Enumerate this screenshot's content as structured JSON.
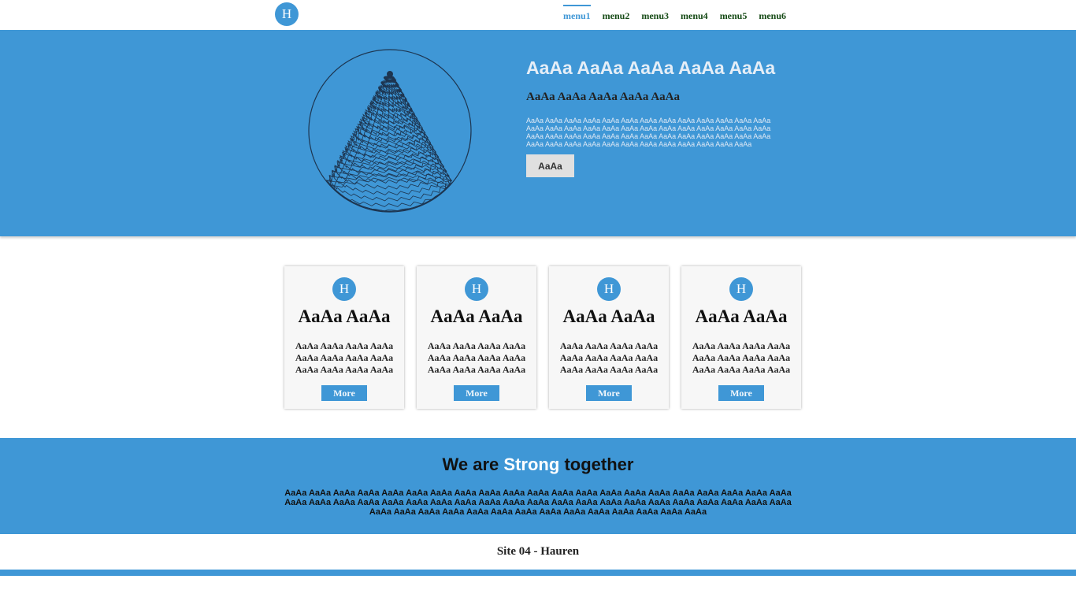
{
  "header": {
    "logo_letter": "H",
    "nav": [
      {
        "label": "menu1",
        "active": true
      },
      {
        "label": "menu2"
      },
      {
        "label": "menu3"
      },
      {
        "label": "menu4"
      },
      {
        "label": "menu5"
      },
      {
        "label": "menu6"
      }
    ]
  },
  "hero": {
    "image_icon": "sphere-illustration",
    "title": "AaAa AaAa AaAa AaAa AaAa",
    "subtitle": "AaAa AaAa AaAa AaAa AaAa",
    "text": "AaAa AaAa AaAa AaAa AaAa AaAa AaAa AaAa AaAa AaAa AaAa AaAa AaAa AaAa AaAa AaAa AaAa AaAa AaAa AaAa AaAa AaAa AaAa AaAa AaAa AaAa AaAa AaAa AaAa AaAa AaAa AaAa AaAa AaAa AaAa AaAa AaAa AaAa AaAa AaAa AaAa AaAa AaAa AaAa AaAa AaAa AaAa AaAa AaAa AaAa AaAa",
    "button_label": "AaAa"
  },
  "cards": [
    {
      "icon_letter": "H",
      "title": "AaAa AaAa",
      "text": "AaAa AaAa AaAa AaAa AaAa AaAa AaAa AaAa AaAa AaAa AaAa AaAa",
      "button_label": "More"
    },
    {
      "icon_letter": "H",
      "title": "AaAa AaAa",
      "text": "AaAa AaAa AaAa AaAa AaAa AaAa AaAa AaAa AaAa AaAa AaAa AaAa",
      "button_label": "More"
    },
    {
      "icon_letter": "H",
      "title": "AaAa AaAa",
      "text": "AaAa AaAa AaAa AaAa AaAa AaAa AaAa AaAa AaAa AaAa AaAa AaAa",
      "button_label": "More"
    },
    {
      "icon_letter": "H",
      "title": "AaAa AaAa",
      "text": "AaAa AaAa AaAa AaAa AaAa AaAa AaAa AaAa AaAa AaAa AaAa AaAa",
      "button_label": "More"
    }
  ],
  "band": {
    "title_prefix": "We are",
    "title_highlight": "Strong",
    "title_suffix": "together",
    "text": "AaAa AaAa AaAa AaAa AaAa AaAa AaAa AaAa AaAa AaAa AaAa AaAa AaAa AaAa AaAa AaAa AaAa AaAa AaAa AaAa AaAa AaAa AaAa AaAa AaAa AaAa AaAa AaAa AaAa AaAa AaAa AaAa AaAa AaAa AaAa AaAa AaAa AaAa AaAa AaAa AaAa AaAa AaAa AaAa AaAa AaAa AaAa AaAa AaAa AaAa AaAa AaAa AaAa AaAa AaAa AaAa"
  },
  "footer": {
    "text": "Site 04 - Hauren"
  },
  "colors": {
    "accent": "#3f97d6",
    "nav_text": "#154a15"
  }
}
